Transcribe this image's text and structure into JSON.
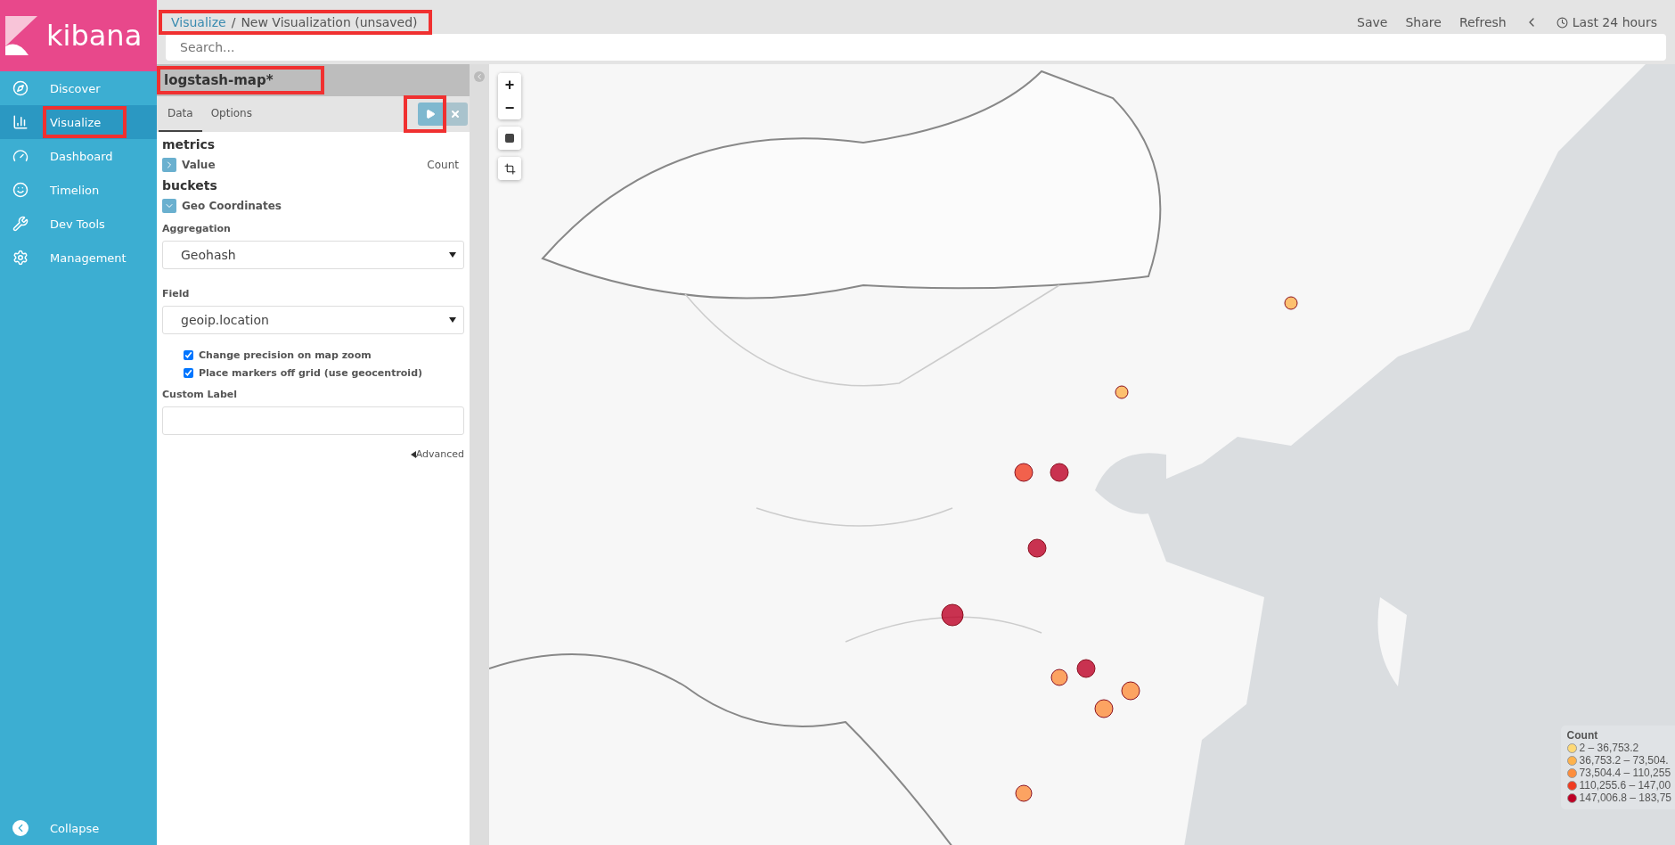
{
  "sidebar": {
    "logo": "kibana",
    "items": [
      {
        "label": "Discover",
        "selected": false
      },
      {
        "label": "Visualize",
        "selected": true
      },
      {
        "label": "Dashboard",
        "selected": false
      },
      {
        "label": "Timelion",
        "selected": false
      },
      {
        "label": "Dev Tools",
        "selected": false
      },
      {
        "label": "Management",
        "selected": false
      }
    ],
    "collapse": "Collapse"
  },
  "header": {
    "breadcrumb": {
      "link": "Visualize",
      "separator": "/",
      "current": "New Visualization (unsaved)"
    },
    "actions": [
      "Save",
      "Share",
      "Refresh"
    ],
    "time": "Last 24 hours",
    "search": {
      "placeholder": "Search..."
    }
  },
  "editor": {
    "title": "logstash-map*",
    "tabs": [
      {
        "label": "Data",
        "selected": true
      },
      {
        "label": "Options",
        "selected": false
      }
    ],
    "metrics_heading": "metrics",
    "metric": {
      "label": "Value",
      "value": "Count"
    },
    "buckets_heading": "buckets",
    "bucket": {
      "label": "Geo Coordinates",
      "expanded": true
    },
    "aggregation": {
      "label": "Aggregation",
      "value": "Geohash"
    },
    "field": {
      "label": "Field",
      "value": "geoip.location"
    },
    "options": [
      {
        "label": "Change precision on map zoom",
        "checked": true
      },
      {
        "label": "Place markers off grid (use geocentroid)",
        "checked": true
      }
    ],
    "custom_label": {
      "label": "Custom Label"
    },
    "advanced": "Advanced"
  },
  "map": {
    "kind": "picture",
    "zoom_in": "+",
    "zoom_out": "−",
    "legend": {
      "title": "Count",
      "items": [
        {
          "label": "2 – 36,753.2",
          "color": "#fed976"
        },
        {
          "label": "36,753.2 – 73,504.",
          "color": "#feb24c"
        },
        {
          "label": "73,504.4 – 110,255",
          "color": "#fd8d3c"
        },
        {
          "label": "110,255.6 – 147,00",
          "color": "#f03b20"
        },
        {
          "label": "147,006.8 – 183,75",
          "color": "#bd0026"
        }
      ]
    }
  }
}
